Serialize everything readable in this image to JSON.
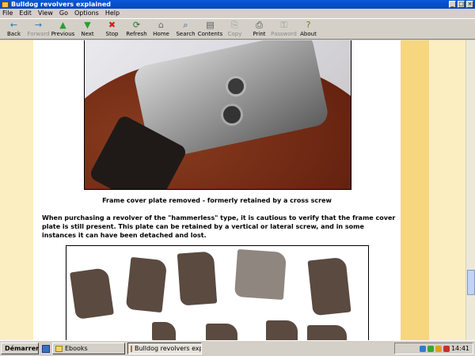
{
  "window": {
    "title": "Bulldog revolvers explained",
    "controls": [
      "_",
      "□",
      "×"
    ]
  },
  "menu": [
    "File",
    "Edit",
    "View",
    "Go",
    "Options",
    "Help"
  ],
  "toolbar": [
    {
      "label": "Back",
      "icon": "←",
      "color": "#1f77b4",
      "enabled": true
    },
    {
      "label": "Forward",
      "icon": "→",
      "color": "#1f77b4",
      "enabled": false
    },
    {
      "label": "Previous",
      "icon": "▲",
      "color": "#22a32a",
      "enabled": true
    },
    {
      "label": "Next",
      "icon": "▼",
      "color": "#22a32a",
      "enabled": true
    },
    {
      "label": "Stop",
      "icon": "✖",
      "color": "#d21f1f",
      "enabled": true
    },
    {
      "label": "Refresh",
      "icon": "⟳",
      "color": "#2b6d2b",
      "enabled": true
    },
    {
      "label": "Home",
      "icon": "⌂",
      "color": "#6b6b6b",
      "enabled": true
    },
    {
      "label": "Search",
      "icon": "⌕",
      "color": "#355a8a",
      "enabled": true
    },
    {
      "label": "Contents",
      "icon": "▤",
      "color": "#5a5a5a",
      "enabled": true
    },
    {
      "label": "Copy",
      "icon": "⎘",
      "color": "#9a9a9a",
      "enabled": false
    },
    {
      "label": "Print",
      "icon": "⎙",
      "color": "#444444",
      "enabled": true
    },
    {
      "label": "Password",
      "icon": "⚿",
      "color": "#9a9a9a",
      "enabled": false
    },
    {
      "label": "About",
      "icon": "?",
      "color": "#6a7a2a",
      "enabled": true
    }
  ],
  "content": {
    "caption1": "Frame cover plate removed - formerly retained by a cross screw",
    "paragraph": "When purchasing a revolver of the \"hammerless\" type, it is cautious to verify that the frame cover plate is still present. This plate can be retained by a vertical or lateral screw, and in some instances it can have been detached and lost."
  },
  "taskbar": {
    "start_label": "Démarrer",
    "tasks": [
      {
        "label": "Ebooks",
        "active": false
      },
      {
        "label": "Bulldog revolvers exp...",
        "active": true
      }
    ],
    "clock": "14:41"
  }
}
